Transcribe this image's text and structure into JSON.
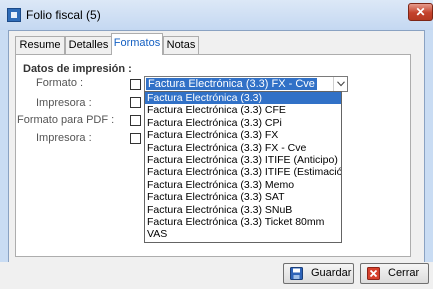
{
  "window": {
    "title": "Folio fiscal (5)",
    "close_label": "✕"
  },
  "tabs": [
    {
      "label": "Resume",
      "active": false
    },
    {
      "label": "Detalles",
      "active": false
    },
    {
      "label": "Formatos",
      "active": true
    },
    {
      "label": "Notas",
      "active": false
    }
  ],
  "panel": {
    "section_title": "Datos de impresión :",
    "fields": {
      "formato": "Formato :",
      "impresora1": "Impresora :",
      "formato_pdf": "Formato para PDF :",
      "impresora2": "Impresora :"
    }
  },
  "combo": {
    "selected_value": "Factura Electrónica (3.3) FX - Cve"
  },
  "dropdown": {
    "options": [
      "Factura Electrónica (3.3)",
      "Factura Electrónica (3.3) CFE",
      "Factura Electrónica (3.3) CPi",
      "Factura Electrónica (3.3) FX",
      "Factura Electrónica (3.3) FX - Cve",
      "Factura Electrónica (3.3) ITIFE (Anticipo)",
      "Factura Electrónica (3.3) ITIFE (Estimación)",
      "Factura Electrónica (3.3) Memo",
      "Factura Electrónica (3.3) SAT",
      "Factura Electrónica (3.3) SNuB",
      "Factura Electrónica (3.3) Ticket 80mm",
      "VAS"
    ],
    "highlighted": "Factura Electrónica (3.3)"
  },
  "buttons": {
    "guardar": "Guardar",
    "cerrar": "Cerrar"
  },
  "colors": {
    "accent": "#3171c7",
    "close": "#c4422c",
    "tab_active_text": "#1560c2"
  }
}
